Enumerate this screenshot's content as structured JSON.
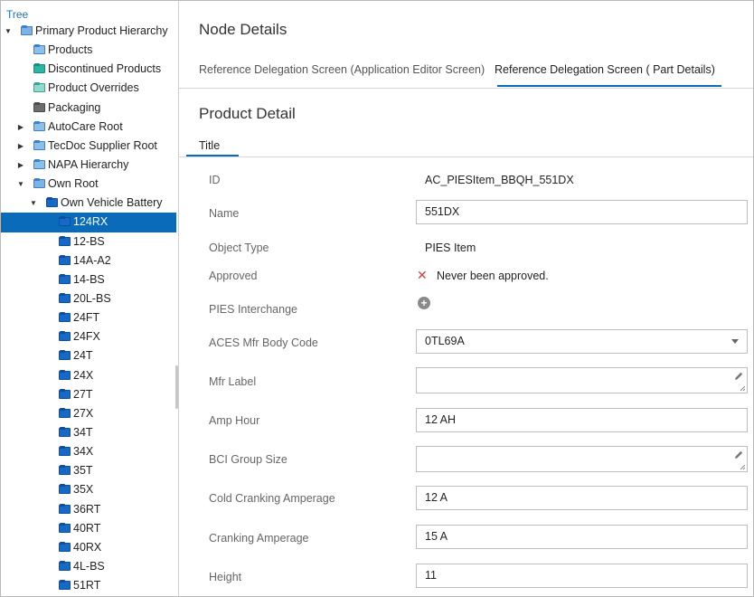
{
  "tree": {
    "header": "Tree",
    "items": [
      {
        "label": "Primary Product Hierarchy",
        "twisty": "▼",
        "icon": "folder-open-blue"
      },
      {
        "label": "Products",
        "twisty": "",
        "icon": "folder-blue"
      },
      {
        "label": "Discontinued Products",
        "twisty": "",
        "icon": "folder-teal"
      },
      {
        "label": "Product Overrides",
        "twisty": "",
        "icon": "folder-lightteal"
      },
      {
        "label": "Packaging",
        "twisty": "",
        "icon": "folder-gray"
      },
      {
        "label": "AutoCare Root",
        "twisty": "▶",
        "icon": "folder-blue"
      },
      {
        "label": "TecDoc Supplier Root",
        "twisty": "▶",
        "icon": "folder-blue"
      },
      {
        "label": "NAPA Hierarchy",
        "twisty": "▶",
        "icon": "folder-blue"
      },
      {
        "label": "Own Root",
        "twisty": "▼",
        "icon": "folder-open-blue"
      },
      {
        "label": "Own Vehicle Battery",
        "twisty": "▼",
        "icon": "folder-navy"
      },
      {
        "label": "124RX",
        "twisty": "",
        "icon": "folder-navy",
        "selected": true
      },
      {
        "label": "12-BS",
        "twisty": "",
        "icon": "folder-navy"
      },
      {
        "label": "14A-A2",
        "twisty": "",
        "icon": "folder-navy"
      },
      {
        "label": "14-BS",
        "twisty": "",
        "icon": "folder-navy"
      },
      {
        "label": "20L-BS",
        "twisty": "",
        "icon": "folder-navy"
      },
      {
        "label": "24FT",
        "twisty": "",
        "icon": "folder-navy"
      },
      {
        "label": "24FX",
        "twisty": "",
        "icon": "folder-navy"
      },
      {
        "label": "24T",
        "twisty": "",
        "icon": "folder-navy"
      },
      {
        "label": "24X",
        "twisty": "",
        "icon": "folder-navy"
      },
      {
        "label": "27T",
        "twisty": "",
        "icon": "folder-navy"
      },
      {
        "label": "27X",
        "twisty": "",
        "icon": "folder-navy"
      },
      {
        "label": "34T",
        "twisty": "",
        "icon": "folder-navy"
      },
      {
        "label": "34X",
        "twisty": "",
        "icon": "folder-navy"
      },
      {
        "label": "35T",
        "twisty": "",
        "icon": "folder-navy"
      },
      {
        "label": "35X",
        "twisty": "",
        "icon": "folder-navy"
      },
      {
        "label": "36RT",
        "twisty": "",
        "icon": "folder-navy"
      },
      {
        "label": "40RT",
        "twisty": "",
        "icon": "folder-navy"
      },
      {
        "label": "40RX",
        "twisty": "",
        "icon": "folder-navy"
      },
      {
        "label": "4L-BS",
        "twisty": "",
        "icon": "folder-navy"
      },
      {
        "label": "51RT",
        "twisty": "",
        "icon": "folder-navy"
      }
    ]
  },
  "node": {
    "title": "Node Details",
    "tabs": [
      "Reference Delegation Screen (Application Editor Screen)",
      "Reference Delegation Screen ( Part Details)"
    ]
  },
  "detail": {
    "title": "Product Detail",
    "subtab": "Title",
    "fields": {
      "id": {
        "label": "ID",
        "value": "AC_PIESItem_BBQH_551DX"
      },
      "name": {
        "label": "Name",
        "value": "551DX"
      },
      "object_type": {
        "label": "Object Type",
        "value": "PIES Item"
      },
      "approved": {
        "label": "Approved",
        "value": "Never been approved.",
        "icon": "x-icon"
      },
      "pies_interchange": {
        "label": "PIES Interchange",
        "icon": "plus-circle-icon"
      },
      "aces_body_code": {
        "label": "ACES Mfr Body Code",
        "value": "0TL69A"
      },
      "mfr_label": {
        "label": "Mfr Label",
        "value": ""
      },
      "amp_hour": {
        "label": "Amp Hour",
        "value": "12 AH"
      },
      "bci_group_size": {
        "label": "BCI Group Size",
        "value": ""
      },
      "cold_cranking": {
        "label": "Cold Cranking Amperage",
        "value": "12 A"
      },
      "cranking": {
        "label": "Cranking Amperage",
        "value": "15 A"
      },
      "height": {
        "label": "Height",
        "value": "11"
      }
    }
  },
  "colors": {
    "accent": "#0a6bbb",
    "error": "#e03a3a"
  }
}
